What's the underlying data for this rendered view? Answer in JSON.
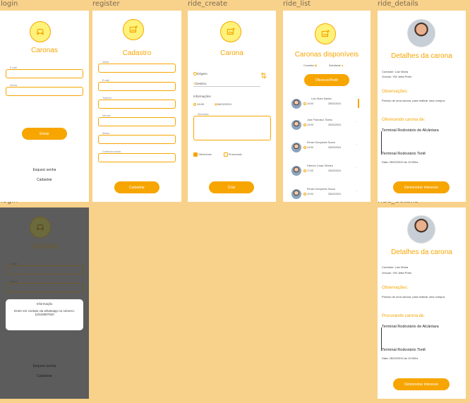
{
  "labels": {
    "login": "login",
    "register": "register",
    "ride_create": "ride_create",
    "ride_list": "ride_list",
    "ride_details": "ride_details",
    "login2": "login",
    "ride_details2": "ride_details"
  },
  "login": {
    "title": "Caronas",
    "email": "E-mail",
    "password": "Senha",
    "submit": "Entrar",
    "forgot": "Esqueci senha",
    "signup": "Cadastrar"
  },
  "register": {
    "title": "Cadastro",
    "fields": [
      "Nome",
      "E-mail",
      "Telefone",
      "Veículo",
      "Senha",
      "Confirmar senha"
    ],
    "submit": "Cadastrar"
  },
  "ride_create": {
    "title": "Carona",
    "origin": "Origem",
    "destination": "Destino",
    "info": "Informações",
    "time": "16:00",
    "date": "26/02/2024",
    "description": "Descrição",
    "offering": "Oferecendo",
    "seeking": "Procurando",
    "submit": "Criar"
  },
  "ride_list": {
    "title": "Caronas disponíveis",
    "driver": "Condutor",
    "requester": "Solicitante",
    "offer_button": "Oferecer/Pedir",
    "items": [
      {
        "name": "Luiz Moira Santos",
        "time": "10:00",
        "date": "26/02/2024"
      },
      {
        "name": "José Francisco Toledo",
        "time": "13:00",
        "date": "26/02/2024"
      },
      {
        "name": "Renan Gonçalves Souza",
        "time": "13:00",
        "date": "26/02/2024"
      },
      {
        "name": "Fabrício Cesar Oliveira",
        "time": "17:00",
        "date": "26/02/2024"
      },
      {
        "name": "Renan Gonçalves Souza",
        "time": "12:00",
        "date": "26/02/2024"
      }
    ]
  },
  "ride_details": {
    "title": "Detalhes da carona",
    "driver": "Condutor: Luiz Moira",
    "vehicle": "Veículo: VW Jetta Preto",
    "obs_title": "Observações:",
    "obs_text": "Preciso de uma carona, para realizar uma compra.",
    "offering_title": "Oferecendo carona de:",
    "from": "Terminal Rodoviário de Alcântara",
    "to": "Terminal Rodoviário  Tietê",
    "date": "Data: 26/02/2024 às 15:00hs",
    "button": "Demonstrar Interesse"
  },
  "login2": {
    "title": "Caronas",
    "email": "E-mail",
    "password": "Senha",
    "modal_title": "Informação",
    "modal_text": "Entre em contato via whatsapp no número: 11942987920",
    "forgot": "Esqueci senha",
    "signup": "Cadastrar"
  },
  "ride_details2": {
    "title": "Detalhes da carona",
    "driver": "Condutor: Luiz Moira",
    "vehicle": "Veículo: VW Jetta Preto",
    "obs_title": "Observações:",
    "obs_text": "Preciso de uma carona, para realizar uma compra.",
    "seeking_title": "Procurando carona de:",
    "from": "Terminal Rodoviário de Alcântara",
    "to": "Terminal Rodoviário  Tietê",
    "date": "Data: 26/02/2024 às 15:00hs",
    "button": "Demonstrar Interesse"
  }
}
